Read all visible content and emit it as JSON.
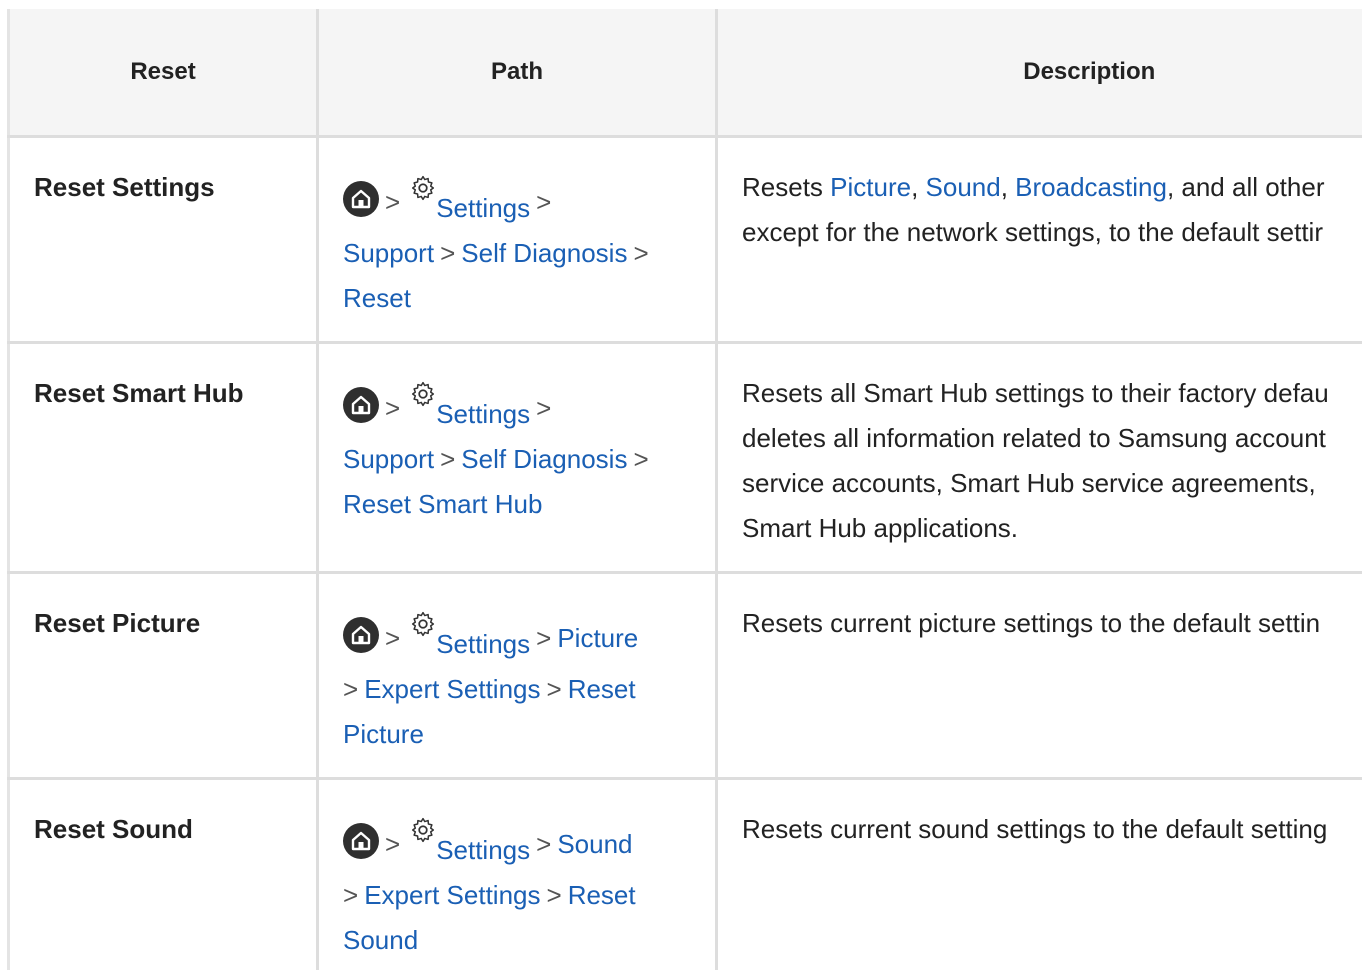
{
  "headers": {
    "reset": "Reset",
    "path": "Path",
    "description": "Description"
  },
  "separator": ">",
  "rows": [
    {
      "name": "Reset Settings",
      "path": [
        "Settings",
        "Support",
        "Self Diagnosis",
        "Reset"
      ],
      "desc": {
        "pre": "Resets ",
        "link1": "Picture",
        "c1": ", ",
        "link2": "Sound",
        "c2": ", ",
        "link3": "Broadcasting",
        "post": ", and all other",
        "line2": "except for the network settings, to the default settir"
      }
    },
    {
      "name": "Reset Smart Hub",
      "path": [
        "Settings",
        "Support",
        "Self Diagnosis",
        "Reset Smart Hub"
      ],
      "desc": {
        "line1": "Resets all Smart Hub settings to their factory defau",
        "line2": "deletes all information related to Samsung account",
        "line3": "service accounts, Smart Hub service agreements,",
        "line4": "Smart Hub applications."
      }
    },
    {
      "name": "Reset Picture",
      "path": [
        "Settings",
        "Picture",
        "Expert Settings",
        "Reset",
        "Picture"
      ],
      "desc": {
        "line1": "Resets current picture settings to the default settin"
      }
    },
    {
      "name": "Reset Sound",
      "path": [
        "Settings",
        "Sound",
        "Expert Settings",
        "Reset",
        "Sound"
      ],
      "desc": {
        "line1": "Resets current sound settings to the default setting"
      }
    }
  ],
  "icons": {
    "home": "home-icon",
    "settings": "gear-icon"
  },
  "colors": {
    "link": "#1a5fb4",
    "header_bg": "#f5f5f5",
    "border": "#dddddd",
    "home_icon_bg": "#2f2f2f"
  }
}
